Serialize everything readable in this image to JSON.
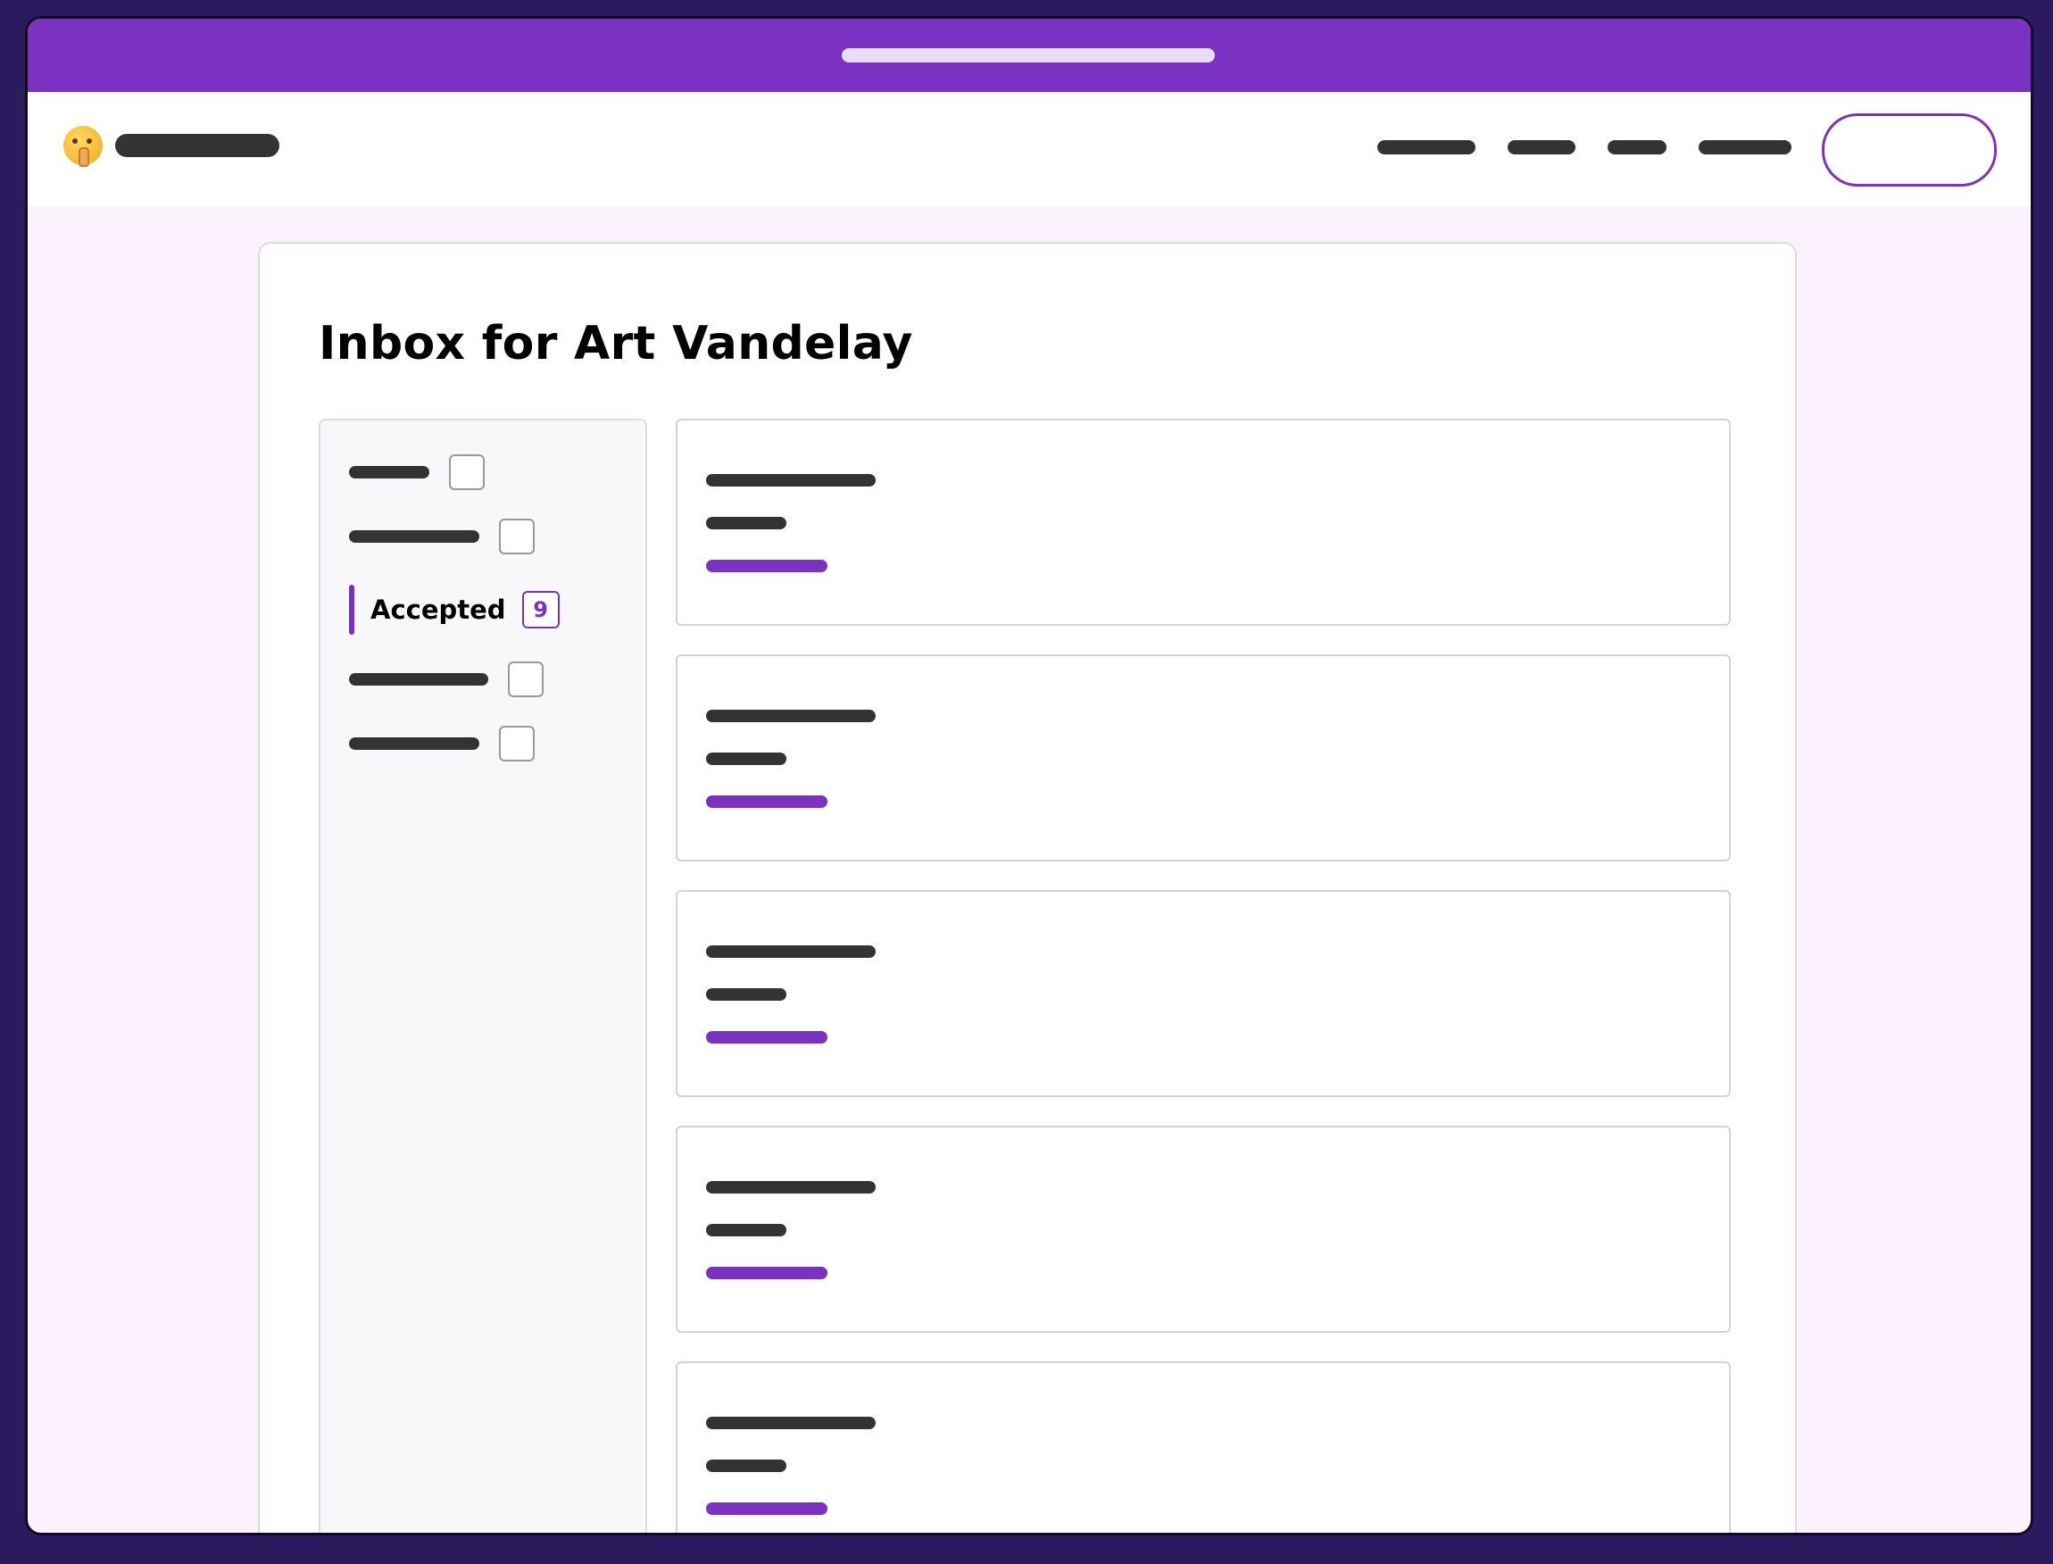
{
  "colors": {
    "accent": "#7b31c2",
    "page_background": "#fcf2fd",
    "placeholder_text": "#333333"
  },
  "brand": {
    "icon": "shushing-face-emoji-icon"
  },
  "page": {
    "title": "Inbox for Art Vandelay"
  },
  "sidebar": {
    "active_filter": {
      "label": "Accepted",
      "count": "9"
    }
  }
}
